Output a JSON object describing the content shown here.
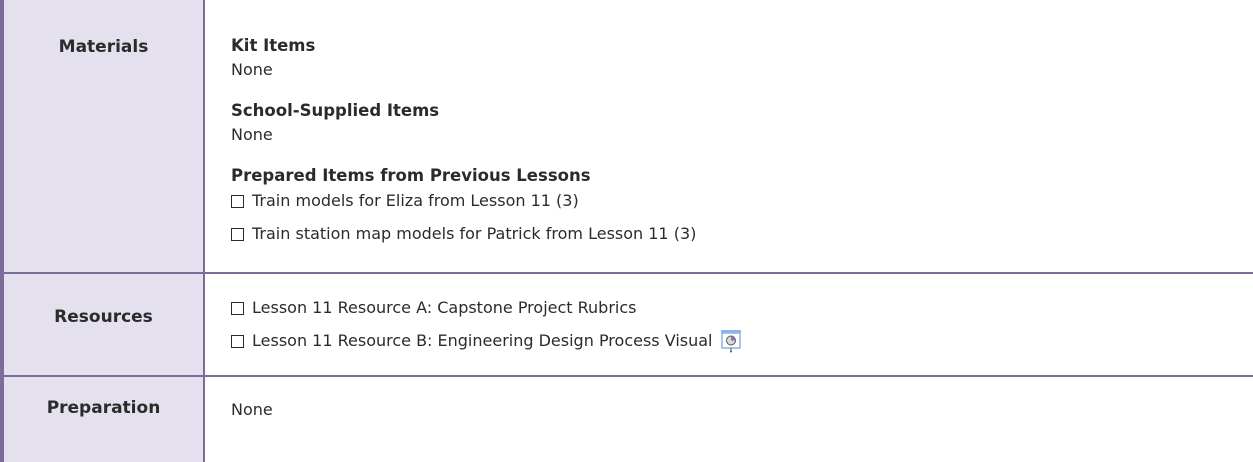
{
  "rows": {
    "materials": {
      "label": "Materials",
      "kit": {
        "heading": "Kit Items",
        "value": "None"
      },
      "school": {
        "heading": "School-Supplied Items",
        "value": "None"
      },
      "prepared": {
        "heading": "Prepared Items from Previous Lessons",
        "items": [
          "Train models for Eliza from Lesson 11 (3)",
          "Train station map models for Patrick from Lesson 11 (3)"
        ]
      }
    },
    "resources": {
      "label": "Resources",
      "items": [
        "Lesson 11 Resource A: Capstone Project Rubrics",
        "Lesson 11 Resource B: Engineering Design Process Visual"
      ],
      "icon": "slide-projection-icon"
    },
    "preparation": {
      "label": "Preparation",
      "value": "None"
    }
  },
  "colors": {
    "label_bg": "#e5e0ee",
    "border": "#7f6a9e",
    "icon_accent": "#8ab4e6"
  }
}
